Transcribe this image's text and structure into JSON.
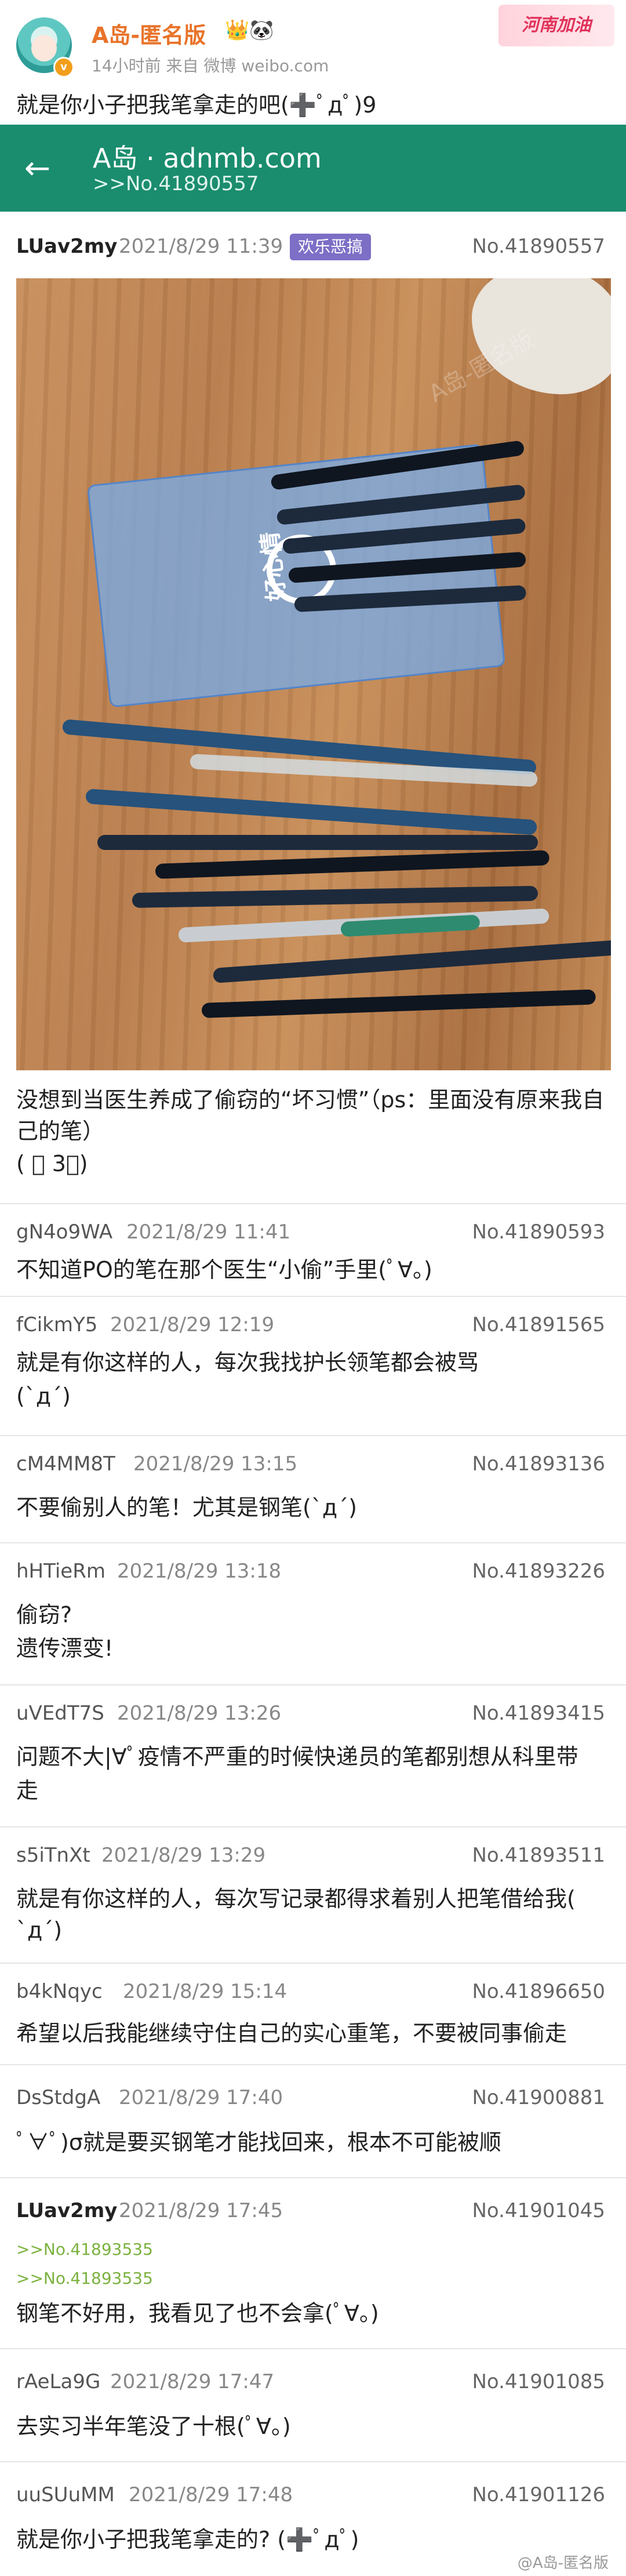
{
  "weibo": {
    "name": "A岛-匿名版",
    "meta": "14小时前  来自 微博 weibo.com",
    "badge": "河南加油",
    "text": "就是你小子把我笔拿走的吧(➕ﾟдﾟ)9"
  },
  "appbar": {
    "title": "A岛 · adnmb.com",
    "subtitle": ">>No.41890557"
  },
  "posts": [
    {
      "uid": "LUav2my",
      "time": "2021/8/29 11:39",
      "tag": "欢乐恶搞",
      "no": "No.41890557",
      "body": "没想到当医生养成了偷窃的“坏习惯”（ps：里面没有原来我自己的笔）",
      "body2": "( ﾟ 3ﾟ)"
    },
    {
      "uid": "gN4o9WA",
      "time": "2021/8/29 11:41",
      "no": "No.41890593",
      "body": "不知道PO的笔在那个医生“小偷”手里(ﾟ∀。)"
    },
    {
      "uid": "fCikmY5",
      "time": "2021/8/29 12:19",
      "no": "No.41891565",
      "body": "就是有你这样的人，每次我找护长领笔都会被骂",
      "body2": "(`д´)"
    },
    {
      "uid": "cM4MM8T",
      "time": "2021/8/29 13:15",
      "no": "No.41893136",
      "body": "不要偷别人的笔！尤其是钢笔(`д´)"
    },
    {
      "uid": "hHTieRm",
      "time": "2021/8/29 13:18",
      "no": "No.41893226",
      "body": "偷窃?",
      "body2": "遗传漂变!"
    },
    {
      "uid": "uVEdT7S",
      "time": "2021/8/29 13:26",
      "no": "No.41893415",
      "body": "问题不大|∀ﾟ疫情不严重的时候快递员的笔都别想从科里带",
      "body2": "走"
    },
    {
      "uid": "s5iTnXt",
      "time": "2021/8/29 13:29",
      "no": "No.41893511",
      "body": "就是有你这样的人，每次写记录都得求着别人把笔借给我(",
      "body2": "`д´)"
    },
    {
      "uid": "b4kNqyc",
      "time": "2021/8/29 15:14",
      "no": "No.41896650",
      "body": "希望以后我能继续守住自己的实心重笔，不要被同事偷走"
    },
    {
      "uid": "DsStdgA",
      "time": "2021/8/29 17:40",
      "no": "No.41900881",
      "body": "ﾟ∀ﾟ)σ就是要买钢笔才能找回来，根本不可能被顺"
    },
    {
      "uid": "LUav2my",
      "time": "2021/8/29 17:45",
      "no": "No.41901045",
      "ref1": ">>No.41893535",
      "ref2": ">>No.41893535",
      "body": "钢笔不好用，我看见了也不会拿(ﾟ∀。)"
    },
    {
      "uid": "rAeLa9G",
      "time": "2021/8/29 17:47",
      "no": "No.41901085",
      "body": "去实习半年笔没了十根(ﾟ∀。)"
    },
    {
      "uid": "uuSUuMM",
      "time": "2021/8/29 17:48",
      "no": "No.41901126",
      "body": "就是你小子把我笔拿走的? (➕ﾟдﾟ)"
    }
  ],
  "photo": {
    "bag_brand": "好心情",
    "watermark": "A岛-匿名版"
  },
  "footer": {
    "watermark": "@A岛-匿名版"
  },
  "colors": {
    "appbar": "#1a8d6e",
    "weibo_name": "#e8732a",
    "tag": "#7d6ec6",
    "ref": "#7bb23f"
  }
}
